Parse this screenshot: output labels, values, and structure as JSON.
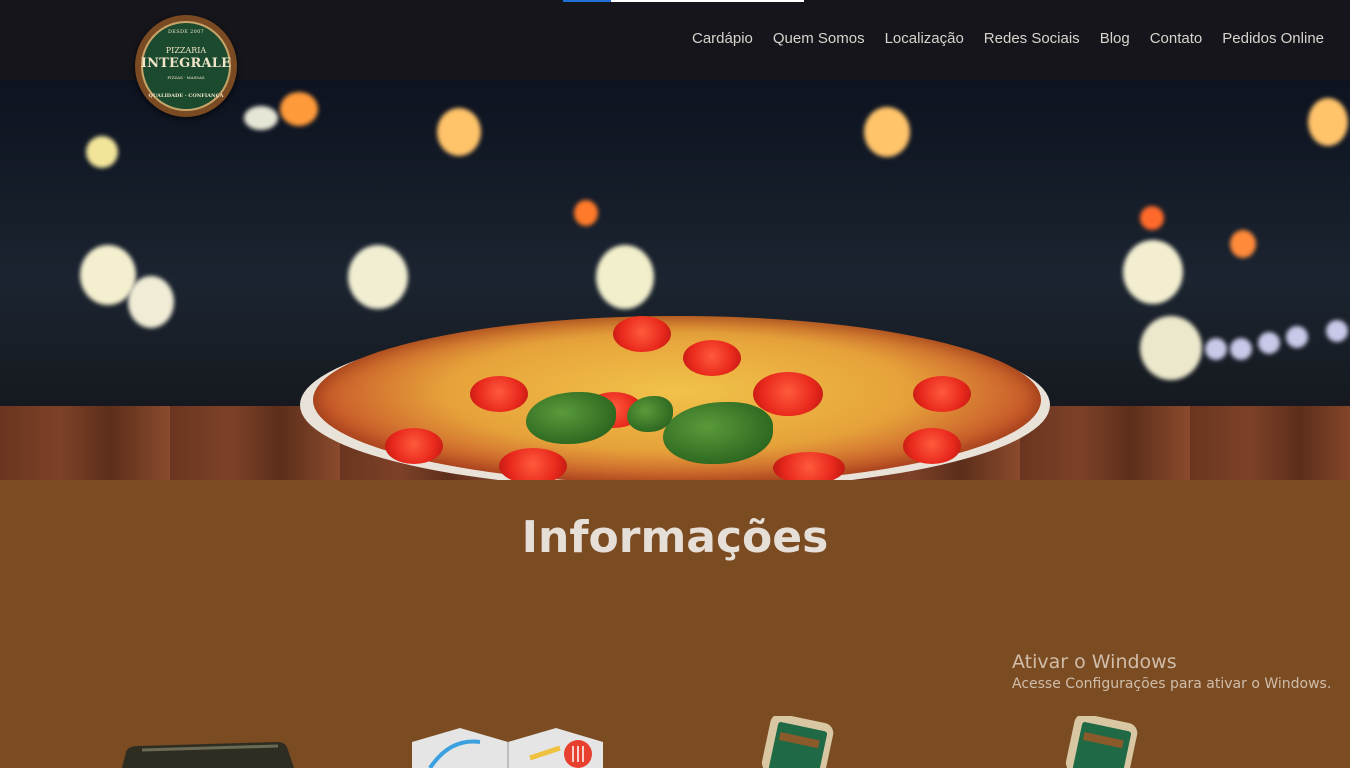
{
  "header": {
    "logo": {
      "since": "DESDE 2007",
      "top": "PIZZARIA",
      "name": "INTEGRALE",
      "sub": "PIZZAS · MASSAS",
      "bottom": "QUALIDADE · CONFIANÇA"
    },
    "nav": [
      {
        "label": "Cardápio"
      },
      {
        "label": "Quem Somos"
      },
      {
        "label": "Localização"
      },
      {
        "label": "Redes Sociais"
      },
      {
        "label": "Blog"
      },
      {
        "label": "Contato"
      },
      {
        "label": "Pedidos Online"
      }
    ]
  },
  "hero": {
    "image": "pizza-on-wooden-table-bokeh-background"
  },
  "info": {
    "title": "Informações",
    "cards": [
      {
        "icon": "wallet-icon"
      },
      {
        "icon": "map-icon"
      },
      {
        "icon": "smartphone-icon"
      },
      {
        "icon": "smartphone-icon"
      }
    ]
  },
  "watermark": {
    "title": "Ativar o Windows",
    "subtitle": "Acesse Configurações para ativar o Windows."
  },
  "colors": {
    "topbar": "#15151b",
    "section_bg": "#7b4b22",
    "nav_text": "#d8d3cd",
    "title_text": "#e6dfd8"
  }
}
